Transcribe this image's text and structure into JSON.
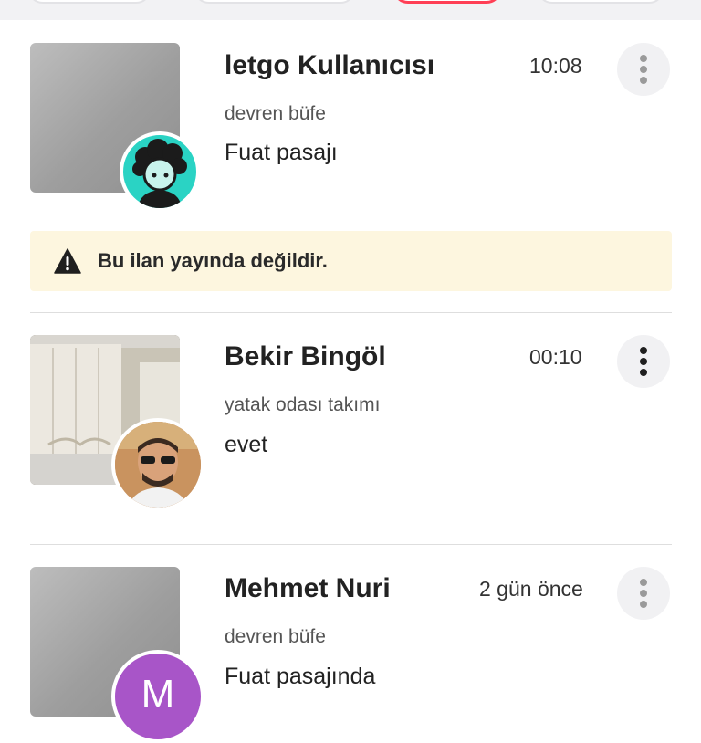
{
  "colors": {
    "accent": "#ff3f55",
    "warning_bg": "#fdf6df",
    "avatar_teal": "#2ad3c4",
    "avatar_purple": "#a855c8"
  },
  "filters": [
    "",
    "",
    "",
    ""
  ],
  "conversations": [
    {
      "name": "letgo Kullanıcısı",
      "time": "10:08",
      "subject": "devren büfe",
      "message": "Fuat pasajı",
      "warning": "Bu ilan yayında değildir.",
      "avatar_icon": "default-user-avatar-icon",
      "thumb": "blurred-gray-image"
    },
    {
      "name": "Bekir Bingöl",
      "time": "00:10",
      "subject": "yatak odası takımı",
      "message": "evet",
      "avatar_icon": "user-photo-avatar",
      "thumb": "bedroom-wardrobe-photo"
    },
    {
      "name": "Mehmet Nuri",
      "time": "2 gün önce",
      "subject": "devren büfe",
      "message": "Fuat pasajında",
      "avatar_initial": "M",
      "thumb": "blurred-gray-image"
    }
  ],
  "icons": {
    "more": "more-vertical-icon",
    "warning": "warning-triangle-icon"
  }
}
